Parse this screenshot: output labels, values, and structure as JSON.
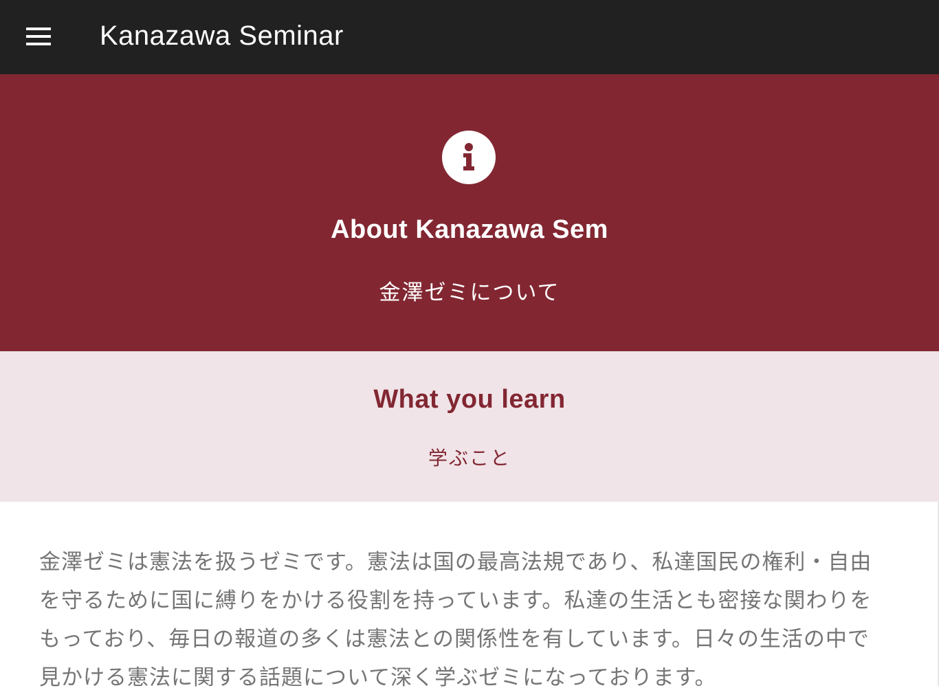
{
  "app": {
    "title": "Kanazawa Seminar"
  },
  "colors": {
    "topbar": "#212121",
    "hero_background": "#822732",
    "learn_background": "#f0e4e8",
    "accent": "#822732",
    "body_text": "#757575"
  },
  "icons": {
    "menu": "hamburger-menu-icon",
    "info": "info-circle-icon"
  },
  "hero": {
    "title": "About Kanazawa Sem",
    "subtitle": "金澤ゼミについて"
  },
  "learn": {
    "title": "What you learn",
    "subtitle": "学ぶこと"
  },
  "content": {
    "paragraph": "金澤ゼミは憲法を扱うゼミです。憲法は国の最高法規であり、私達国民の権利・自由を守るために国に縛りをかける役割を持っています。私達の生活とも密接な関わりをもっており、毎日の報道の多くは憲法との関係性を有しています。日々の生活の中で見かける憲法に関する話題について深く学ぶゼミになっております。"
  }
}
